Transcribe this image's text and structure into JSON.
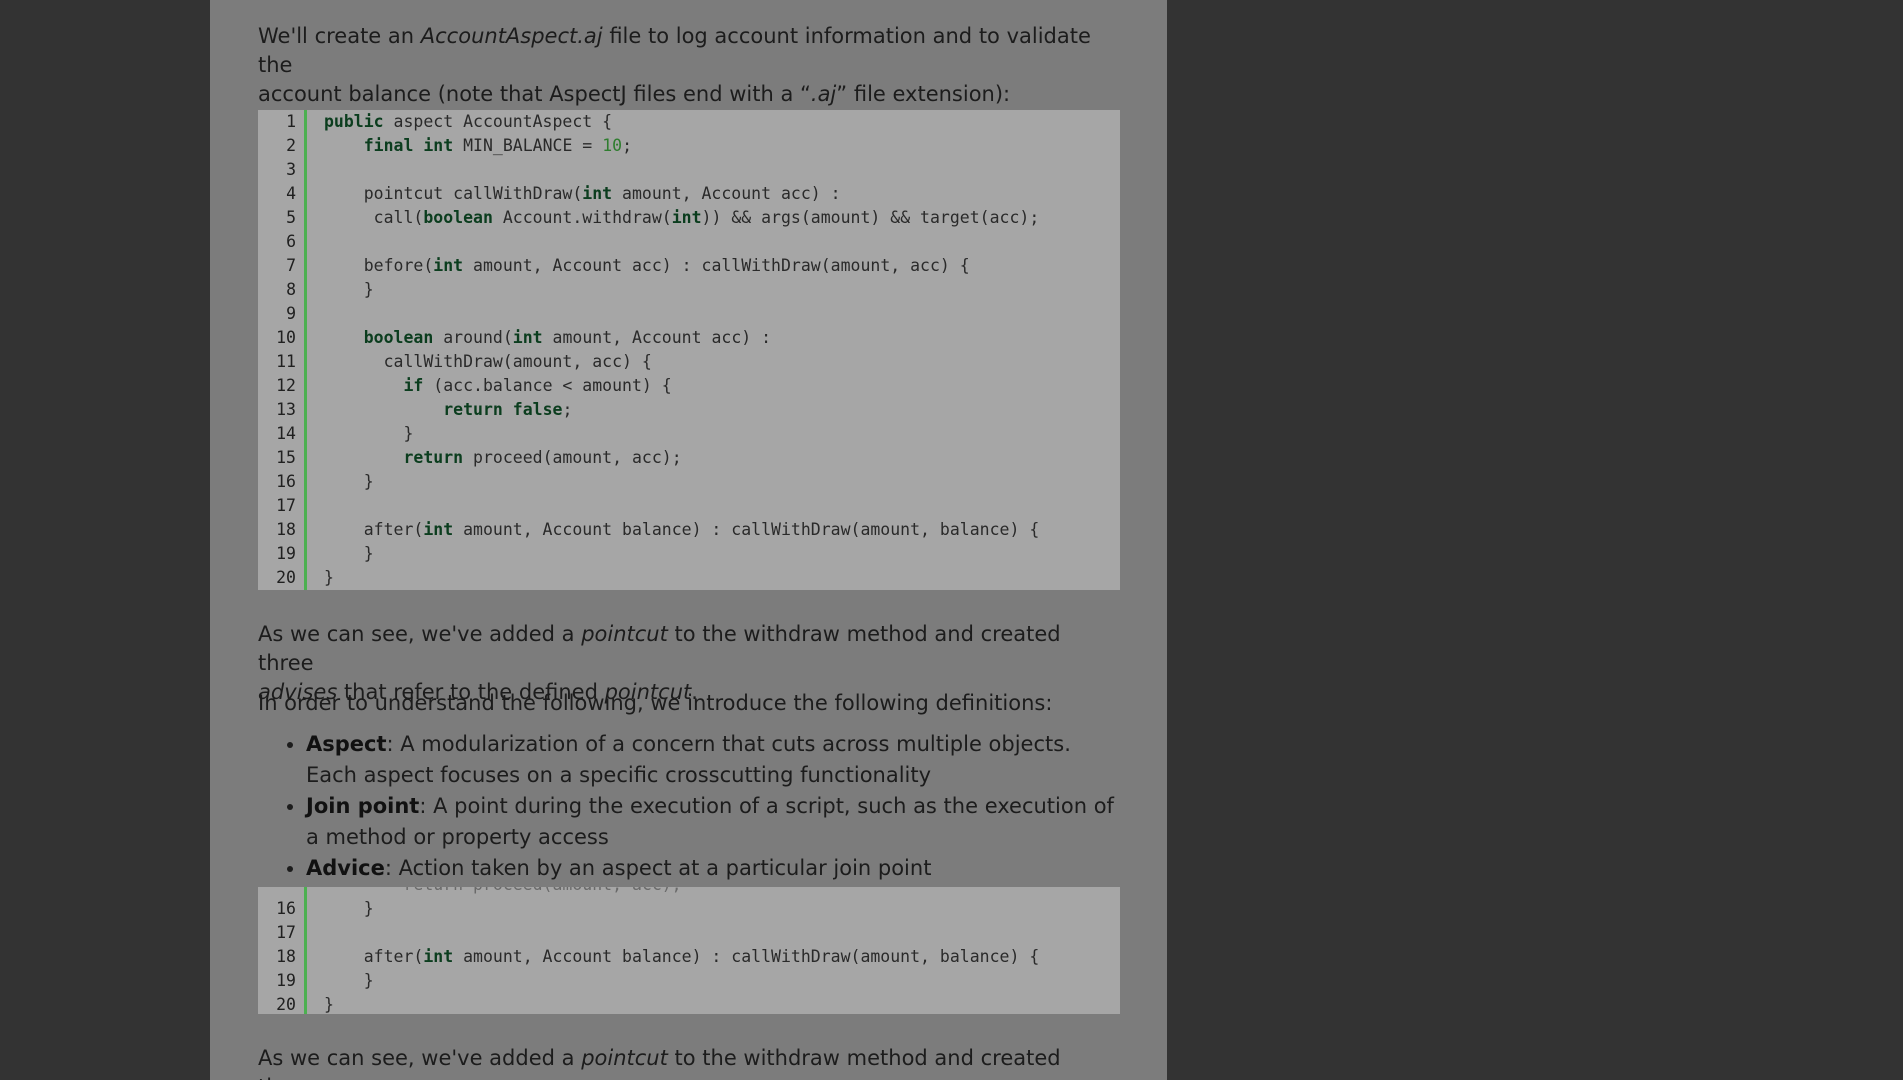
{
  "intro": {
    "text_a": "We'll create an ",
    "italic_a": "AccountAspect.aj",
    "text_b": " file to log account information and to validate the",
    "line2_a": "account balance (note that AspectJ files end with a “",
    "italic_b": ".aj",
    "line2_b": "” file extension):"
  },
  "code_lines": [
    {
      "n": "1",
      "html": "<span class=\"kw\">public</span> aspect AccountAspect {"
    },
    {
      "n": "2",
      "html": "    <span class=\"kw\">final</span> <span class=\"kw\">int</span> MIN_BALANCE = <span class=\"num\">10</span>;"
    },
    {
      "n": "3",
      "html": ""
    },
    {
      "n": "4",
      "html": "    pointcut callWithDraw(<span class=\"kw\">int</span> amount, Account acc) :"
    },
    {
      "n": "5",
      "html": "     call(<span class=\"kw\">boolean</span> Account.withdraw(<span class=\"kw\">int</span>)) &amp;&amp; args(amount) &amp;&amp; target(acc);"
    },
    {
      "n": "6",
      "html": ""
    },
    {
      "n": "7",
      "html": "    before(<span class=\"kw\">int</span> amount, Account acc) : callWithDraw(amount, acc) {"
    },
    {
      "n": "8",
      "html": "    }"
    },
    {
      "n": "9",
      "html": ""
    },
    {
      "n": "10",
      "html": "    <span class=\"kw\">boolean</span> around(<span class=\"kw\">int</span> amount, Account acc) :"
    },
    {
      "n": "11",
      "html": "      callWithDraw(amount, acc) {"
    },
    {
      "n": "12",
      "html": "        <span class=\"kw\">if</span> (acc.balance &lt; amount) {"
    },
    {
      "n": "13",
      "html": "            <span class=\"kw\">return</span> <span class=\"kw\">false</span>;"
    },
    {
      "n": "14",
      "html": "        }"
    },
    {
      "n": "15",
      "html": "        <span class=\"kw\">return</span> proceed(amount, acc);"
    },
    {
      "n": "16",
      "html": "    }"
    },
    {
      "n": "17",
      "html": ""
    },
    {
      "n": "18",
      "html": "    after(<span class=\"kw\">int</span> amount, Account balance) : callWithDraw(amount, balance) {"
    },
    {
      "n": "19",
      "html": "    }"
    },
    {
      "n": "20",
      "html": "}"
    }
  ],
  "after_code": {
    "p1_a": "As we can see, we've added a ",
    "p1_i1": "pointcut",
    "p1_b": " to the withdraw method and created three",
    "p1_i2": "advises",
    "p1_c": " that refer to the defined ",
    "p1_i3": "pointcut",
    "p1_d": ".",
    "p2": "In order to understand the following, we introduce the following definitions:"
  },
  "definitions": [
    {
      "term": "Aspect",
      "desc": ": A modularization of a concern that cuts across multiple objects. Each aspect focuses on a specific crosscutting functionality"
    },
    {
      "term": "Join point",
      "desc": ": A point during the execution of a script, such as the execution of a method or property access"
    },
    {
      "term": "Advice",
      "desc": ": Action taken by an aspect at a particular join point"
    }
  ],
  "repeat_code_lines": [
    {
      "n": "16",
      "html": "    }"
    },
    {
      "n": "17",
      "html": ""
    },
    {
      "n": "18",
      "html": "    after(<span class=\"kw\">int</span> amount, Account balance) : callWithDraw(amount, balance) {"
    },
    {
      "n": "19",
      "html": "    }"
    },
    {
      "n": "20",
      "html": "}"
    }
  ],
  "partial_code_fragment": "        return proceed(amount, acc);",
  "footer_partial": {
    "p_a": "As we can see, we've added a ",
    "p_i": "pointcut",
    "p_b": " to the withdraw method and created three"
  }
}
